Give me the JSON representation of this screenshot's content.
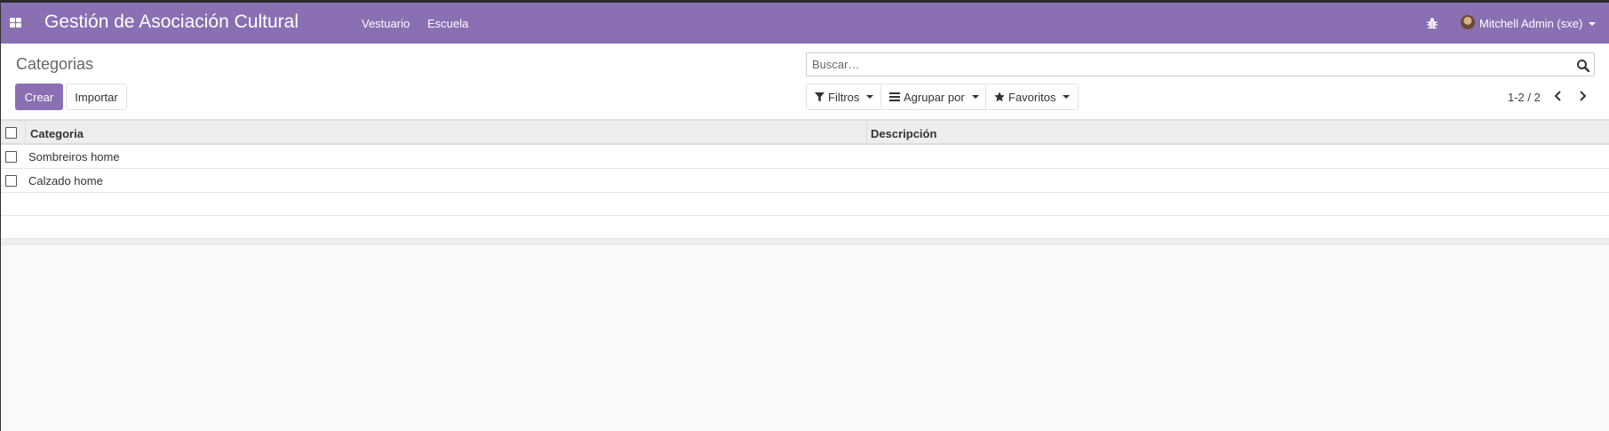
{
  "navbar": {
    "app_title": "Gestión de Asociación Cultural",
    "menu": [
      "Vestuario",
      "Escuela"
    ],
    "user": "Mitchell Admin (sxe)",
    "colors": {
      "primary": "#8a6fb3"
    }
  },
  "control_panel": {
    "breadcrumb": "Categorias",
    "create_label": "Crear",
    "import_label": "Importar",
    "search_placeholder": "Buscar…",
    "filters_label": "Filtros",
    "groupby_label": "Agrupar por",
    "favorites_label": "Favoritos",
    "pager": "1-2 / 2"
  },
  "list": {
    "columns": [
      "Categoria",
      "Descripción"
    ],
    "rows": [
      {
        "categoria": "Sombreiros home",
        "descripcion": ""
      },
      {
        "categoria": "Calzado home",
        "descripcion": ""
      }
    ]
  }
}
